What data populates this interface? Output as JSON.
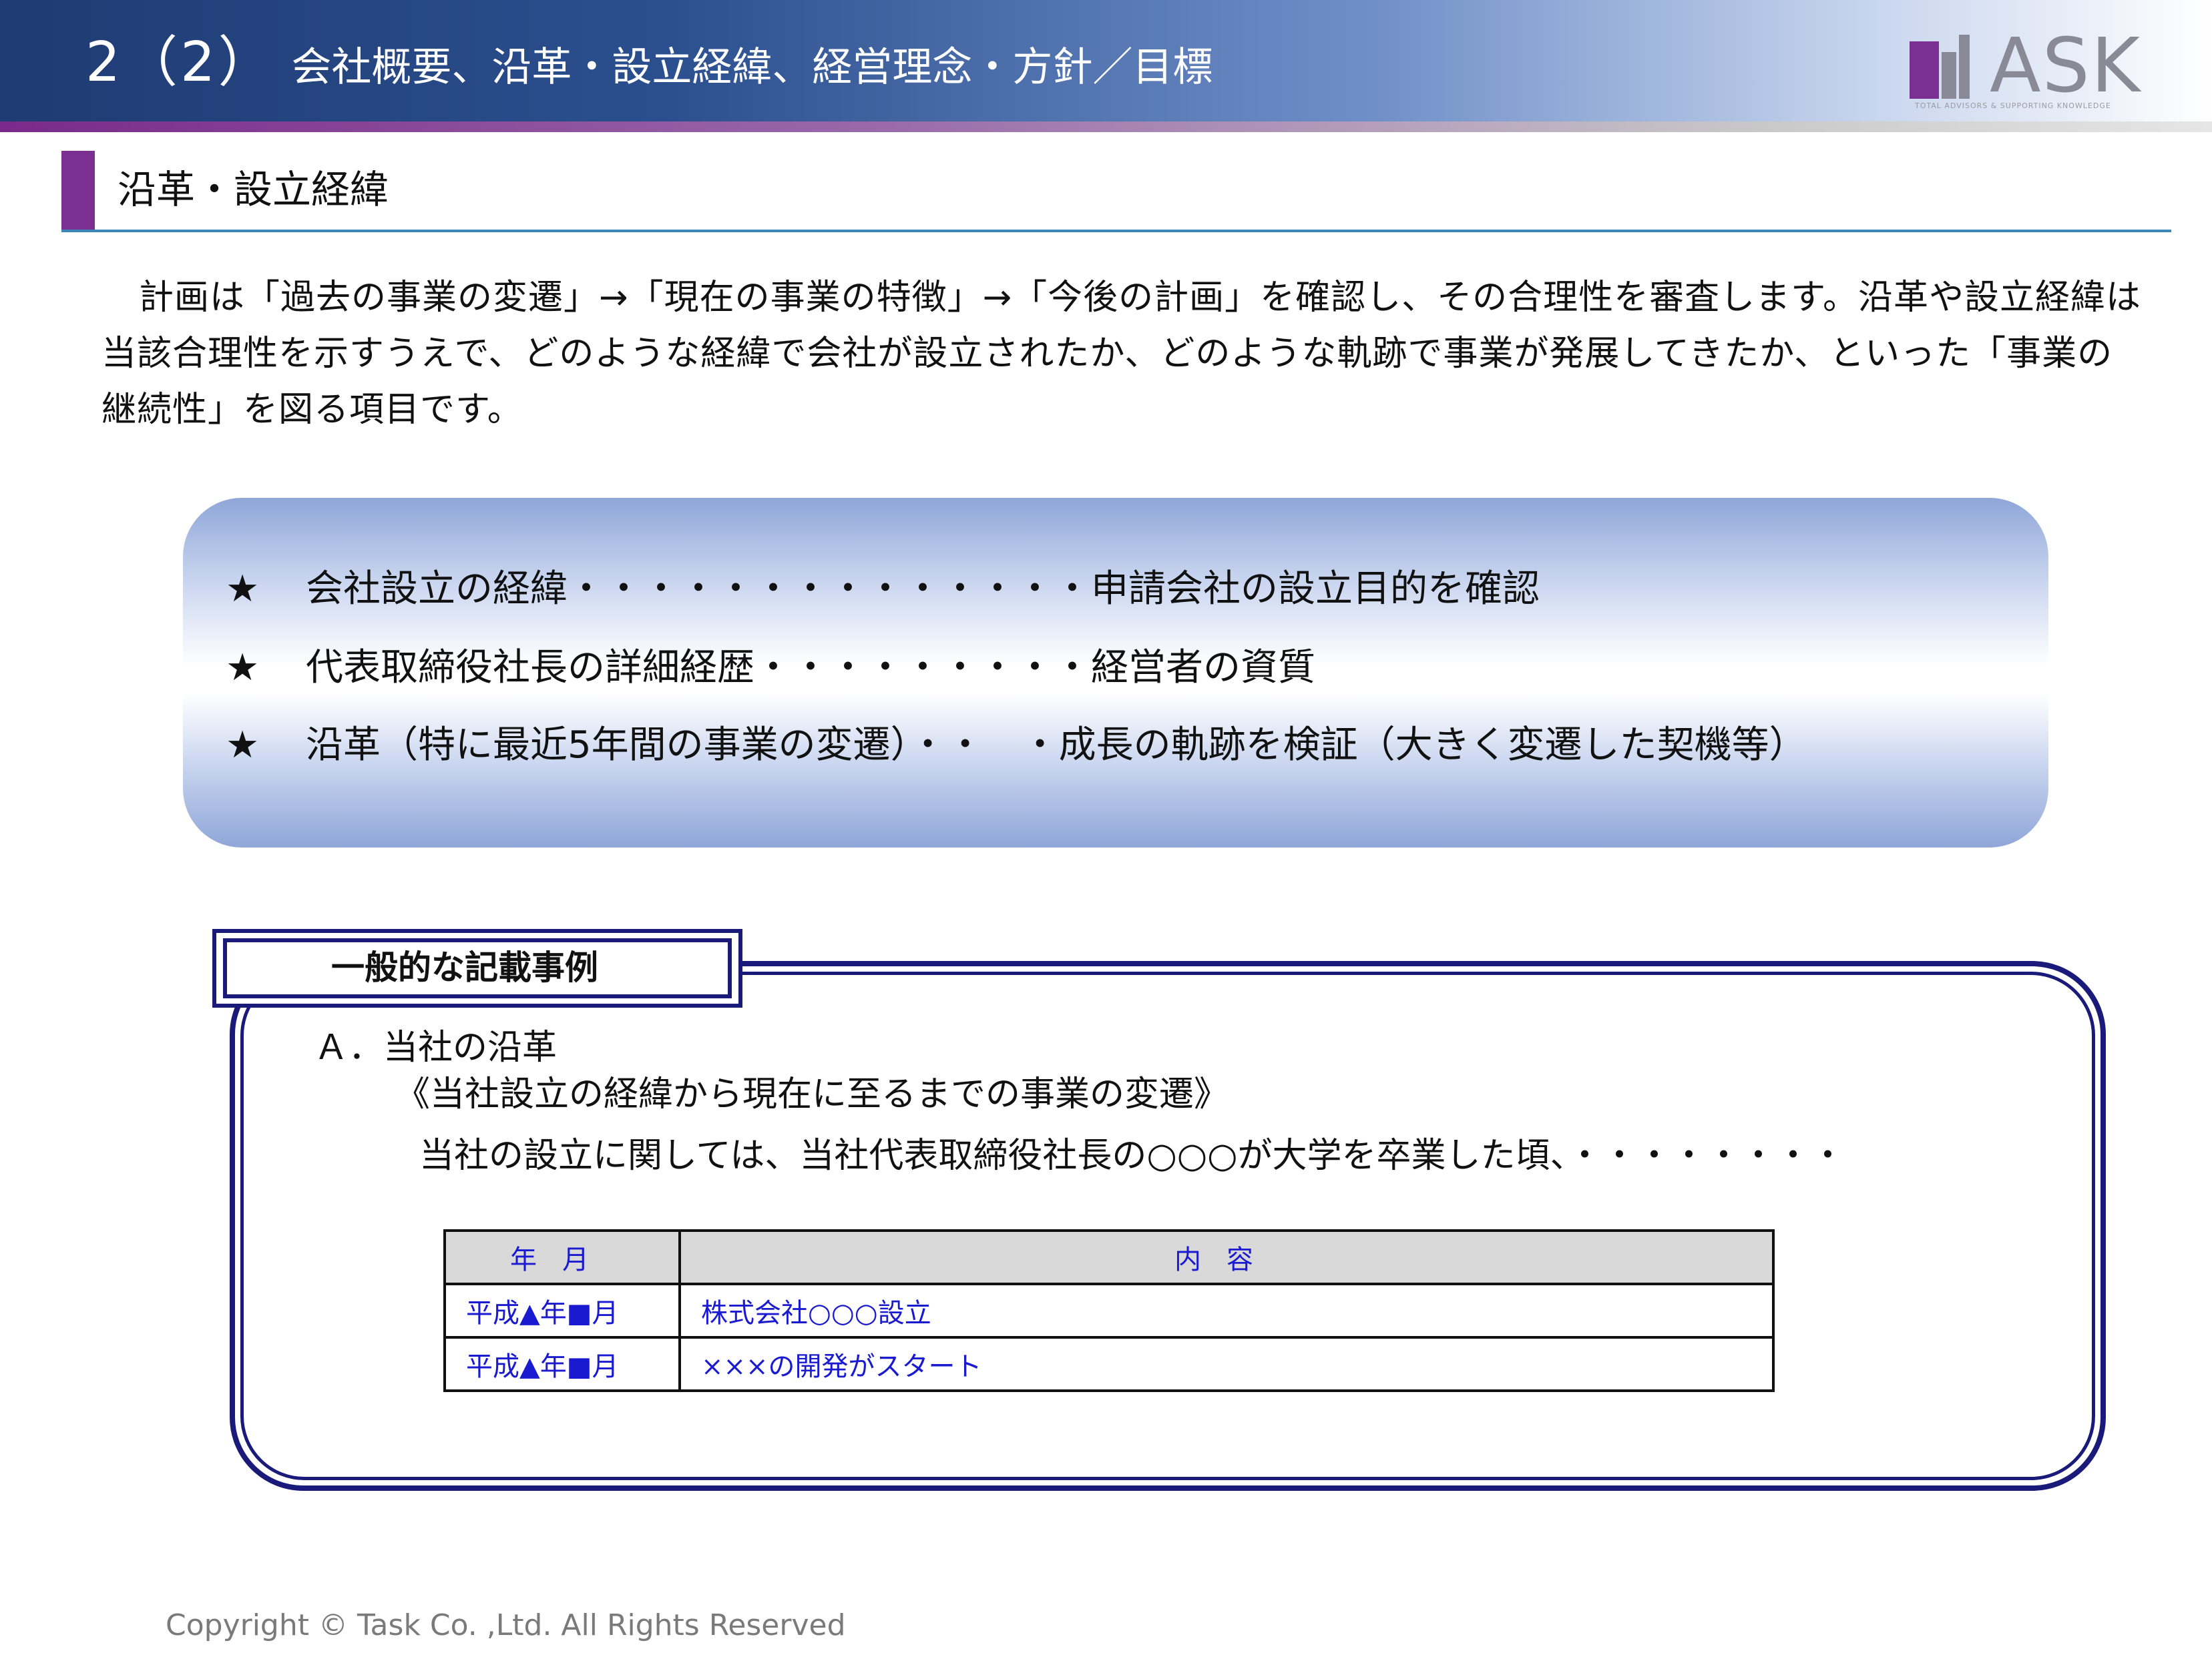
{
  "header": {
    "number": "2（2）",
    "title": "会社概要、沿革・設立経緯、経営理念・方針／目標",
    "logo_text": "ASK",
    "logo_subtext": "TOTAL ADVISORS & SUPPORTING KNOWLEDGE"
  },
  "section": {
    "title": "沿革・設立経緯"
  },
  "intro": "計画は「過去の事業の変遷」→「現在の事業の特徴」→「今後の計画」を確認し、その合理性を審査します。沿革や設立経緯は当該合理性を示すうえで、どのような経緯で会社が設立されたか、どのような軌跡で事業が発展してきたか、といった「事業の継続性」を図る項目です。",
  "checklist": [
    {
      "marker": "★",
      "text": "会社設立の経緯・・・・・・・・・・・・・・申請会社の設立目的を確認"
    },
    {
      "marker": "★",
      "text": "代表取締役社長の詳細経歴・・・・・・・・・経営者の資質"
    },
    {
      "marker": "★",
      "text": "沿革（特に最近5年間の事業の変遷）・・　・成長の軌跡を検証（大きく変遷した契機等）"
    }
  ],
  "example": {
    "label": "一般的な記載事例",
    "heading": "Ａ．当社の沿革",
    "subheading": "《当社設立の経緯から現在に至るまでの事業の変遷》",
    "body": "当社の設立に関しては、当社代表取締役社長の○○○が大学を卒業した頃、・・・・・・・・",
    "table": {
      "headers": [
        "年月",
        "内容"
      ],
      "rows": [
        [
          "平成▲年■月",
          "株式会社○○○設立"
        ],
        [
          "平成▲年■月",
          "×××の開発がスタート"
        ]
      ]
    }
  },
  "footer": "Copyright © Task Co. ,Ltd. All Rights Reserved",
  "colors": {
    "header_navy": "#1f3b73",
    "accent_purple": "#7b2f92",
    "frame_navy": "#1a1a7a",
    "table_text_blue": "#1a1ad0"
  }
}
